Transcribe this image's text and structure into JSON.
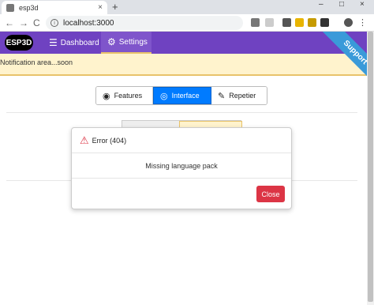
{
  "browser": {
    "tab_title": "esp3d",
    "tab_close": "×",
    "new_tab": "+",
    "url": "localhost:3000",
    "back": "←",
    "forward": "→",
    "reload": "C",
    "win_min": "–",
    "win_max": "□",
    "win_close": "×"
  },
  "app": {
    "logo": "ESP3D",
    "nav": [
      {
        "label": "Dashboard"
      },
      {
        "label": "Settings"
      }
    ],
    "ribbon": "Support us",
    "notification": "Notification area...soon"
  },
  "settings_tabs": [
    {
      "label": "Features",
      "icon": "wifi-icon"
    },
    {
      "label": "Interface",
      "icon": "eye-icon"
    },
    {
      "label": "Repetier",
      "icon": "wrench-icon"
    }
  ],
  "modal": {
    "title": "Error (404)",
    "message": "Missing language pack",
    "close_label": "Close"
  },
  "colors": {
    "appbar": "#6f42c1",
    "primary": "#007bff",
    "danger": "#dc3545",
    "notification_bg": "#fff3cd",
    "ribbon": "#3a9ad9"
  }
}
